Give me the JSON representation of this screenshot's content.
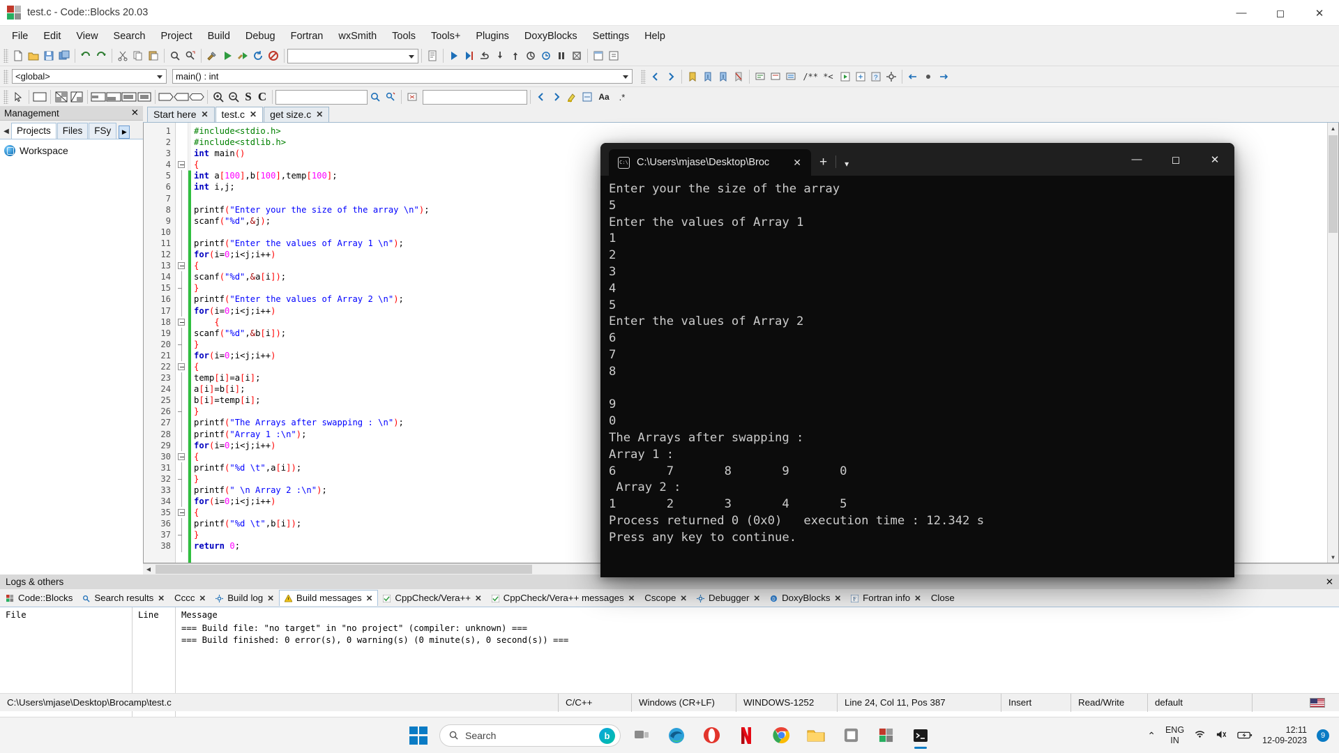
{
  "window": {
    "title": "test.c - Code::Blocks 20.03",
    "minimize": "—",
    "maximize": "☐",
    "close": "✕"
  },
  "menu": {
    "items": [
      "File",
      "Edit",
      "View",
      "Search",
      "Project",
      "Build",
      "Debug",
      "Fortran",
      "wxSmith",
      "Tools",
      "Tools+",
      "Plugins",
      "DoxyBlocks",
      "Settings",
      "Help"
    ]
  },
  "toolbar": {
    "build_target_combo": "",
    "scope_combo": "<global>",
    "function_combo": "main() : int",
    "find_placeholder": "",
    "goto_placeholder": "",
    "doxy_label": "/** *<",
    "zoom_in": "+",
    "zoom_out": "−",
    "sc_label": "S",
    "c_label": "C"
  },
  "management": {
    "title": "Management",
    "close": "✕",
    "tabs": [
      "Projects",
      "Files",
      "FSy"
    ],
    "active_tab": "Projects",
    "workspace_label": "Workspace"
  },
  "editor": {
    "tabs": [
      {
        "label": "Start here",
        "active": false
      },
      {
        "label": "test.c",
        "active": true
      },
      {
        "label": "get size.c",
        "active": false
      }
    ],
    "close_glyph": "✕",
    "lines": [
      {
        "n": 1,
        "fold": "none",
        "html": "<span class='pp'>#include&lt;stdio.h&gt;</span>"
      },
      {
        "n": 2,
        "fold": "none",
        "html": "<span class='pp'>#include&lt;stdlib.h&gt;</span>"
      },
      {
        "n": 3,
        "fold": "none",
        "html": "<span class='k'>int</span> <span class='id'>main</span><span class='pn'>()</span>"
      },
      {
        "n": 4,
        "fold": "box",
        "html": "<span class='pn'>{</span>"
      },
      {
        "n": 5,
        "fold": "bar",
        "html": "<span class='k'>int</span> a<span class='pn'>[</span><span class='nm'>100</span><span class='pn'>]</span>,b<span class='pn'>[</span><span class='nm'>100</span><span class='pn'>]</span>,temp<span class='pn'>[</span><span class='nm'>100</span><span class='pn'>]</span>;"
      },
      {
        "n": 6,
        "fold": "bar",
        "html": "<span class='k'>int</span> i,j;"
      },
      {
        "n": 7,
        "fold": "bar",
        "html": ""
      },
      {
        "n": 8,
        "fold": "bar",
        "html": "printf<span class='pn'>(</span><span class='st'>\"Enter your the size of the array \\n\"</span><span class='pn'>)</span>;"
      },
      {
        "n": 9,
        "fold": "bar",
        "html": "scanf<span class='pn'>(</span><span class='st'>\"%d\"</span>,<span class='op'>&amp;</span>j<span class='pn'>)</span>;"
      },
      {
        "n": 10,
        "fold": "bar",
        "html": ""
      },
      {
        "n": 11,
        "fold": "bar",
        "html": "printf<span class='pn'>(</span><span class='st'>\"Enter the values of Array 1 \\n\"</span><span class='pn'>)</span>;"
      },
      {
        "n": 12,
        "fold": "bar",
        "html": "<span class='k'>for</span><span class='pn'>(</span>i=<span class='nm'>0</span>;i&lt;j;i++<span class='pn'>)</span>"
      },
      {
        "n": 13,
        "fold": "box",
        "html": "<span class='pn'>{</span>"
      },
      {
        "n": 14,
        "fold": "bar",
        "html": "scanf<span class='pn'>(</span><span class='st'>\"%d\"</span>,<span class='op'>&amp;</span>a<span class='pn'>[</span>i<span class='pn'>])</span>;"
      },
      {
        "n": 15,
        "fold": "end",
        "html": "<span class='pn'>}</span>"
      },
      {
        "n": 16,
        "fold": "bar",
        "html": "printf<span class='pn'>(</span><span class='st'>\"Enter the values of Array 2 \\n\"</span><span class='pn'>)</span>;"
      },
      {
        "n": 17,
        "fold": "bar",
        "html": "<span class='k'>for</span><span class='pn'>(</span>i=<span class='nm'>0</span>;i&lt;j;i++<span class='pn'>)</span>"
      },
      {
        "n": 18,
        "fold": "box",
        "html": "    <span class='pn'>{</span>"
      },
      {
        "n": 19,
        "fold": "bar",
        "html": "scanf<span class='pn'>(</span><span class='st'>\"%d\"</span>,<span class='op'>&amp;</span>b<span class='pn'>[</span>i<span class='pn'>])</span>;"
      },
      {
        "n": 20,
        "fold": "end",
        "html": "<span class='pn'>}</span>"
      },
      {
        "n": 21,
        "fold": "bar",
        "html": "<span class='k'>for</span><span class='pn'>(</span>i=<span class='nm'>0</span>;i&lt;j;i++<span class='pn'>)</span>"
      },
      {
        "n": 22,
        "fold": "box",
        "html": "<span class='pn'>{</span>"
      },
      {
        "n": 23,
        "fold": "bar",
        "html": "temp<span class='pn'>[</span>i<span class='pn'>]</span>=a<span class='pn'>[</span>i<span class='pn'>]</span>;"
      },
      {
        "n": 24,
        "fold": "bar",
        "html": "a<span class='pn'>[</span>i<span class='pn'>]</span>=b<span class='pn'>[</span>i<span class='pn'>]</span>;"
      },
      {
        "n": 25,
        "fold": "bar",
        "html": "b<span class='pn'>[</span>i<span class='pn'>]</span>=temp<span class='pn'>[</span>i<span class='pn'>]</span>;"
      },
      {
        "n": 26,
        "fold": "end",
        "html": "<span class='pn'>}</span>"
      },
      {
        "n": 27,
        "fold": "bar",
        "html": "printf<span class='pn'>(</span><span class='st'>\"The Arrays after swapping : \\n\"</span><span class='pn'>)</span>;"
      },
      {
        "n": 28,
        "fold": "bar",
        "html": "printf<span class='pn'>(</span><span class='st'>\"Array 1 :\\n\"</span><span class='pn'>)</span>;"
      },
      {
        "n": 29,
        "fold": "bar",
        "html": "<span class='k'>for</span><span class='pn'>(</span>i=<span class='nm'>0</span>;i&lt;j;i++<span class='pn'>)</span>"
      },
      {
        "n": 30,
        "fold": "box",
        "html": "<span class='pn'>{</span>"
      },
      {
        "n": 31,
        "fold": "bar",
        "html": "printf<span class='pn'>(</span><span class='st'>\"%d \\t\"</span>,a<span class='pn'>[</span>i<span class='pn'>])</span>;"
      },
      {
        "n": 32,
        "fold": "end",
        "html": "<span class='pn'>}</span>"
      },
      {
        "n": 33,
        "fold": "bar",
        "html": "printf<span class='pn'>(</span><span class='st'>\" \\n Array 2 :\\n\"</span><span class='pn'>)</span>;"
      },
      {
        "n": 34,
        "fold": "bar",
        "html": "<span class='k'>for</span><span class='pn'>(</span>i=<span class='nm'>0</span>;i&lt;j;i++<span class='pn'>)</span>"
      },
      {
        "n": 35,
        "fold": "box",
        "html": "<span class='pn'>{</span>"
      },
      {
        "n": 36,
        "fold": "bar",
        "html": "printf<span class='pn'>(</span><span class='st'>\"%d \\t\"</span>,b<span class='pn'>[</span>i<span class='pn'>])</span>;"
      },
      {
        "n": 37,
        "fold": "end",
        "html": "<span class='pn'>}</span>"
      },
      {
        "n": 38,
        "fold": "bar",
        "html": "<span class='k'>return</span> <span class='nm'>0</span>;"
      }
    ]
  },
  "terminal": {
    "tab_title": "C:\\Users\\mjase\\Desktop\\Broc",
    "tab_close": "✕",
    "new_tab": "+",
    "dropdown": "⌄",
    "minimize": "—",
    "maximize": "☐",
    "close": "✕",
    "icon_label": "C:\\",
    "output": "Enter your the size of the array\n5\nEnter the values of Array 1\n1\n2\n3\n4\n5\nEnter the values of Array 2\n6\n7\n8\n\n9\n0\nThe Arrays after swapping :\nArray 1 :\n6       7       8       9       0\n Array 2 :\n1       2       3       4       5\nProcess returned 0 (0x0)   execution time : 12.342 s\nPress any key to continue."
  },
  "logs": {
    "title": "Logs & others",
    "close": "✕",
    "tabs": [
      {
        "label": "Code::Blocks",
        "icon": "codeblocks-icon",
        "closable": false,
        "active": false
      },
      {
        "label": "Search results",
        "icon": "search-icon",
        "closable": true,
        "active": false
      },
      {
        "label": "Cccc",
        "icon": "",
        "closable": true,
        "active": false
      },
      {
        "label": "Build log",
        "icon": "gear-icon",
        "closable": true,
        "active": false
      },
      {
        "label": "Build messages",
        "icon": "warning-icon",
        "closable": true,
        "active": true
      },
      {
        "label": "CppCheck/Vera++",
        "icon": "check-icon",
        "closable": true,
        "active": false
      },
      {
        "label": "CppCheck/Vera++ messages",
        "icon": "check-icon",
        "closable": true,
        "active": false
      },
      {
        "label": "Cscope",
        "icon": "",
        "closable": true,
        "active": false
      },
      {
        "label": "Debugger",
        "icon": "gear-icon",
        "closable": true,
        "active": false
      },
      {
        "label": "DoxyBlocks",
        "icon": "doxy-icon",
        "closable": true,
        "active": false
      },
      {
        "label": "Fortran info",
        "icon": "f-icon",
        "closable": true,
        "active": false
      },
      {
        "label": "Close",
        "icon": "",
        "closable": false,
        "active": false
      }
    ],
    "columns": [
      "File",
      "Line",
      "Message"
    ],
    "messages": [
      "=== Build file: \"no target\" in \"no project\" (compiler: unknown) ===",
      "=== Build finished: 0 error(s), 0 warning(s) (0 minute(s), 0 second(s)) ==="
    ]
  },
  "statusbar": {
    "path": "C:\\Users\\mjase\\Desktop\\Brocamp\\test.c",
    "language": "C/C++",
    "eol": "Windows (CR+LF)",
    "encoding": "WINDOWS-1252",
    "caret": "Line 24, Col 11, Pos 387",
    "mode": "Insert",
    "readwrite": "Read/Write",
    "profile": "default"
  },
  "taskbar": {
    "search_placeholder": "Search",
    "bing_label": "b",
    "time": "12:11",
    "date": "12-09-2023",
    "lang_line1": "ENG",
    "lang_line2": "IN",
    "notification_count": "9",
    "chevron": "⌃"
  }
}
